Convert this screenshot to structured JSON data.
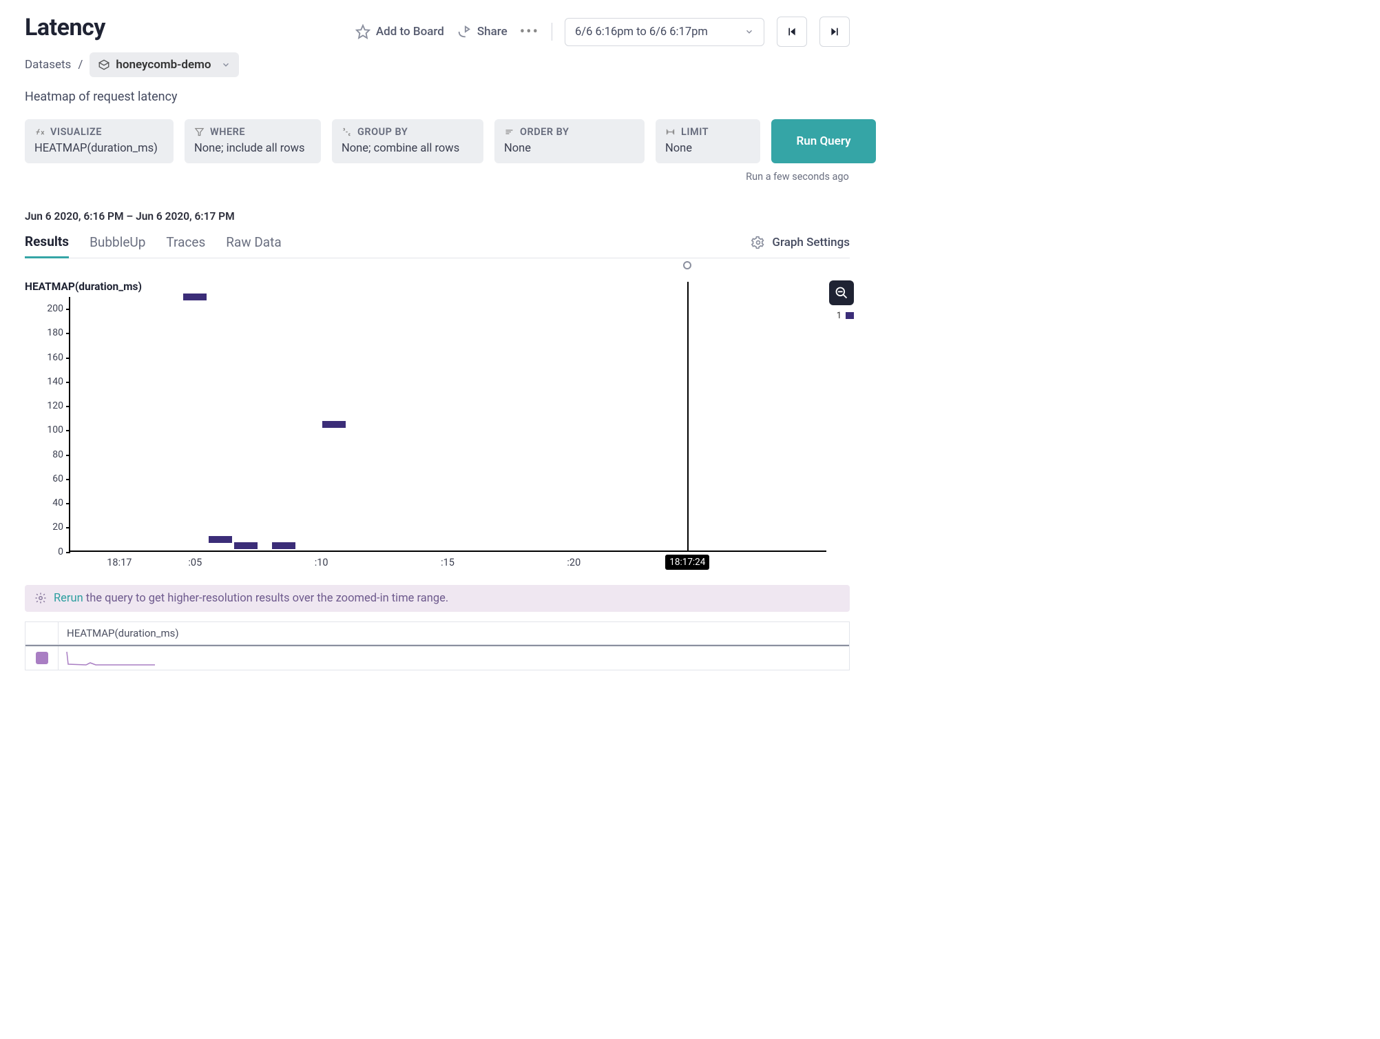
{
  "header": {
    "title": "Latency",
    "add_to_board": "Add to Board",
    "share": "Share",
    "time_range": "6/6 6:16pm to 6/6 6:17pm"
  },
  "breadcrumb": {
    "root": "Datasets",
    "sep": "/",
    "dataset": "honeycomb-demo"
  },
  "subtitle": "Heatmap of request latency",
  "query": {
    "visualize": {
      "label": "VISUALIZE",
      "value": "HEATMAP(duration_ms)"
    },
    "where": {
      "label": "WHERE",
      "value": "None; include all rows"
    },
    "group_by": {
      "label": "GROUP BY",
      "value": "None; combine all rows"
    },
    "order_by": {
      "label": "ORDER BY",
      "value": "None"
    },
    "limit": {
      "label": "LIMIT",
      "value": "None"
    },
    "run_label": "Run Query",
    "run_meta": "Run a few seconds ago"
  },
  "timerange_label": "Jun 6 2020, 6:16 PM – Jun 6 2020, 6:17 PM",
  "tabs": {
    "results": "Results",
    "bubbleup": "BubbleUp",
    "traces": "Traces",
    "rawdata": "Raw Data",
    "graph_settings": "Graph Settings"
  },
  "chart_data": {
    "type": "heatmap",
    "title": "HEATMAP(duration_ms)",
    "ylabel": "duration_ms",
    "ylim": [
      0,
      210
    ],
    "y_ticks": [
      0,
      20,
      40,
      60,
      80,
      100,
      120,
      140,
      160,
      180,
      200
    ],
    "x_ticks": [
      "18:17",
      ":05",
      ":10",
      ":15",
      ":20"
    ],
    "x_range_seconds": [
      0,
      30
    ],
    "cells": [
      {
        "x_sec": 5,
        "y": 210,
        "count": 1
      },
      {
        "x_sec": 6,
        "y": 10,
        "count": 1
      },
      {
        "x_sec": 7,
        "y": 5,
        "count": 1
      },
      {
        "x_sec": 8.5,
        "y": 5,
        "count": 1
      },
      {
        "x_sec": 10.5,
        "y": 105,
        "count": 1
      }
    ],
    "cursor_sec": 24.5,
    "cursor_label": "18:17:24",
    "legend_value": "1"
  },
  "banner": {
    "link": "Rerun",
    "text": " the query to get higher-resolution results over the zoomed-in time range."
  },
  "mini": {
    "header": "HEATMAP(duration_ms)"
  }
}
